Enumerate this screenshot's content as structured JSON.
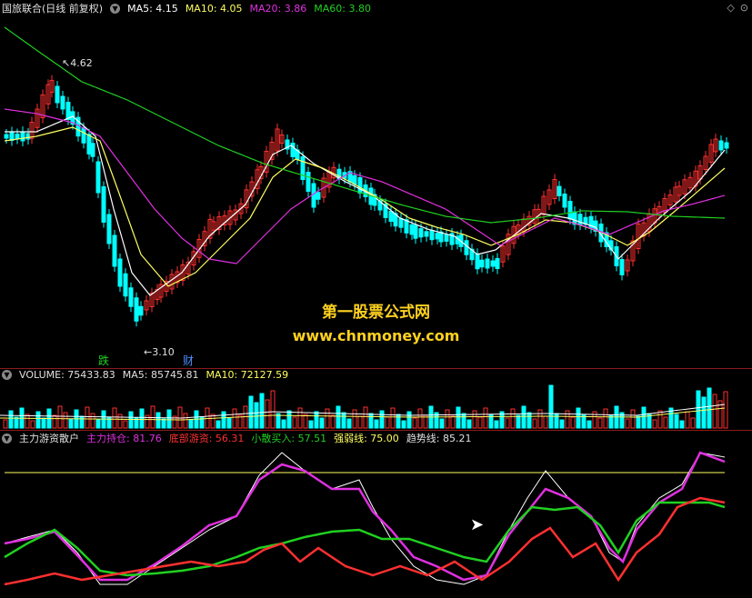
{
  "main": {
    "title": "国旅联合(日线 前复权)",
    "ma5": "MA5: 4.15",
    "ma10": "MA10: 4.05",
    "ma20": "MA20: 3.86",
    "ma60": "MA60: 3.80",
    "high_label": "4.62",
    "low_label": "3.10",
    "mark_fall": "跌",
    "mark_cai": "财",
    "watermark_cn": "第一股票公式网",
    "watermark_url": "www.chnmoney.com",
    "colors": {
      "up": "#ff3030",
      "down": "#00ffff",
      "ma5": "#ffffff",
      "ma10": "#ffff60",
      "ma20": "#e030e0",
      "ma60": "#20d020"
    }
  },
  "volume": {
    "title": "VOLUME: 75433.83",
    "ma5": "MA5: 85745.81",
    "ma10": "MA10: 72127.59"
  },
  "indicator": {
    "title": "主力游资散户",
    "main_hold": "主力持仓: 81.76",
    "bottom_hot": "底部游资: 56.31",
    "retail_buy": "小散买入: 57.51",
    "strength": "强弱线: 75.00",
    "trend": "趋势线: 85.21"
  },
  "icons": {
    "settings": "gear-icon",
    "toggle": "diamond-icon",
    "collapse": "chevron-down-icon"
  }
}
